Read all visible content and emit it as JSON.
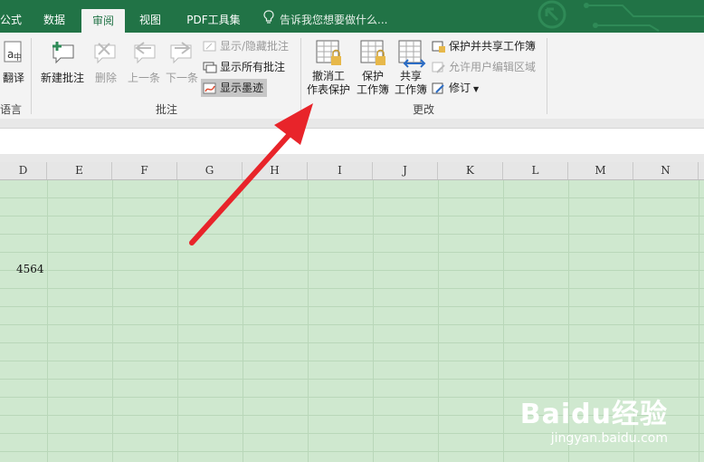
{
  "tabs": [
    {
      "label": "公式"
    },
    {
      "label": "数据"
    },
    {
      "label": "审阅"
    },
    {
      "label": "视图"
    },
    {
      "label": "PDF工具集"
    }
  ],
  "tell_me": "告诉我您想要做什么...",
  "ribbon": {
    "translate_label": "翻译",
    "language_group": "语言",
    "comments": {
      "new_comment": "新建批注",
      "delete": "删除",
      "previous": "上一条",
      "next": "下一条",
      "show_hide": "显示/隐藏批注",
      "show_all": "显示所有批注",
      "show_ink": "显示墨迹",
      "group": "批注"
    },
    "changes": {
      "unprotect_sheet_1": "撤消工",
      "unprotect_sheet_2": "作表保护",
      "protect_workbook_1": "保护",
      "protect_workbook_2": "工作簿",
      "share_workbook_1": "共享",
      "share_workbook_2": "工作簿",
      "protect_share": "保护并共享工作簿",
      "allow_edit_ranges": "允许用户编辑区域",
      "track_changes": "修订",
      "group": "更改"
    }
  },
  "columns": [
    "D",
    "E",
    "F",
    "G",
    "H",
    "I",
    "J",
    "K",
    "L",
    "M",
    "N"
  ],
  "cell_value": "4564",
  "watermark": {
    "brand": "Baidu经验",
    "url": "jingyan.baidu.com"
  },
  "colors": {
    "excel_green": "#217346",
    "arrow_red": "#e8242a",
    "sheet_bg": "#cfe8cf"
  }
}
